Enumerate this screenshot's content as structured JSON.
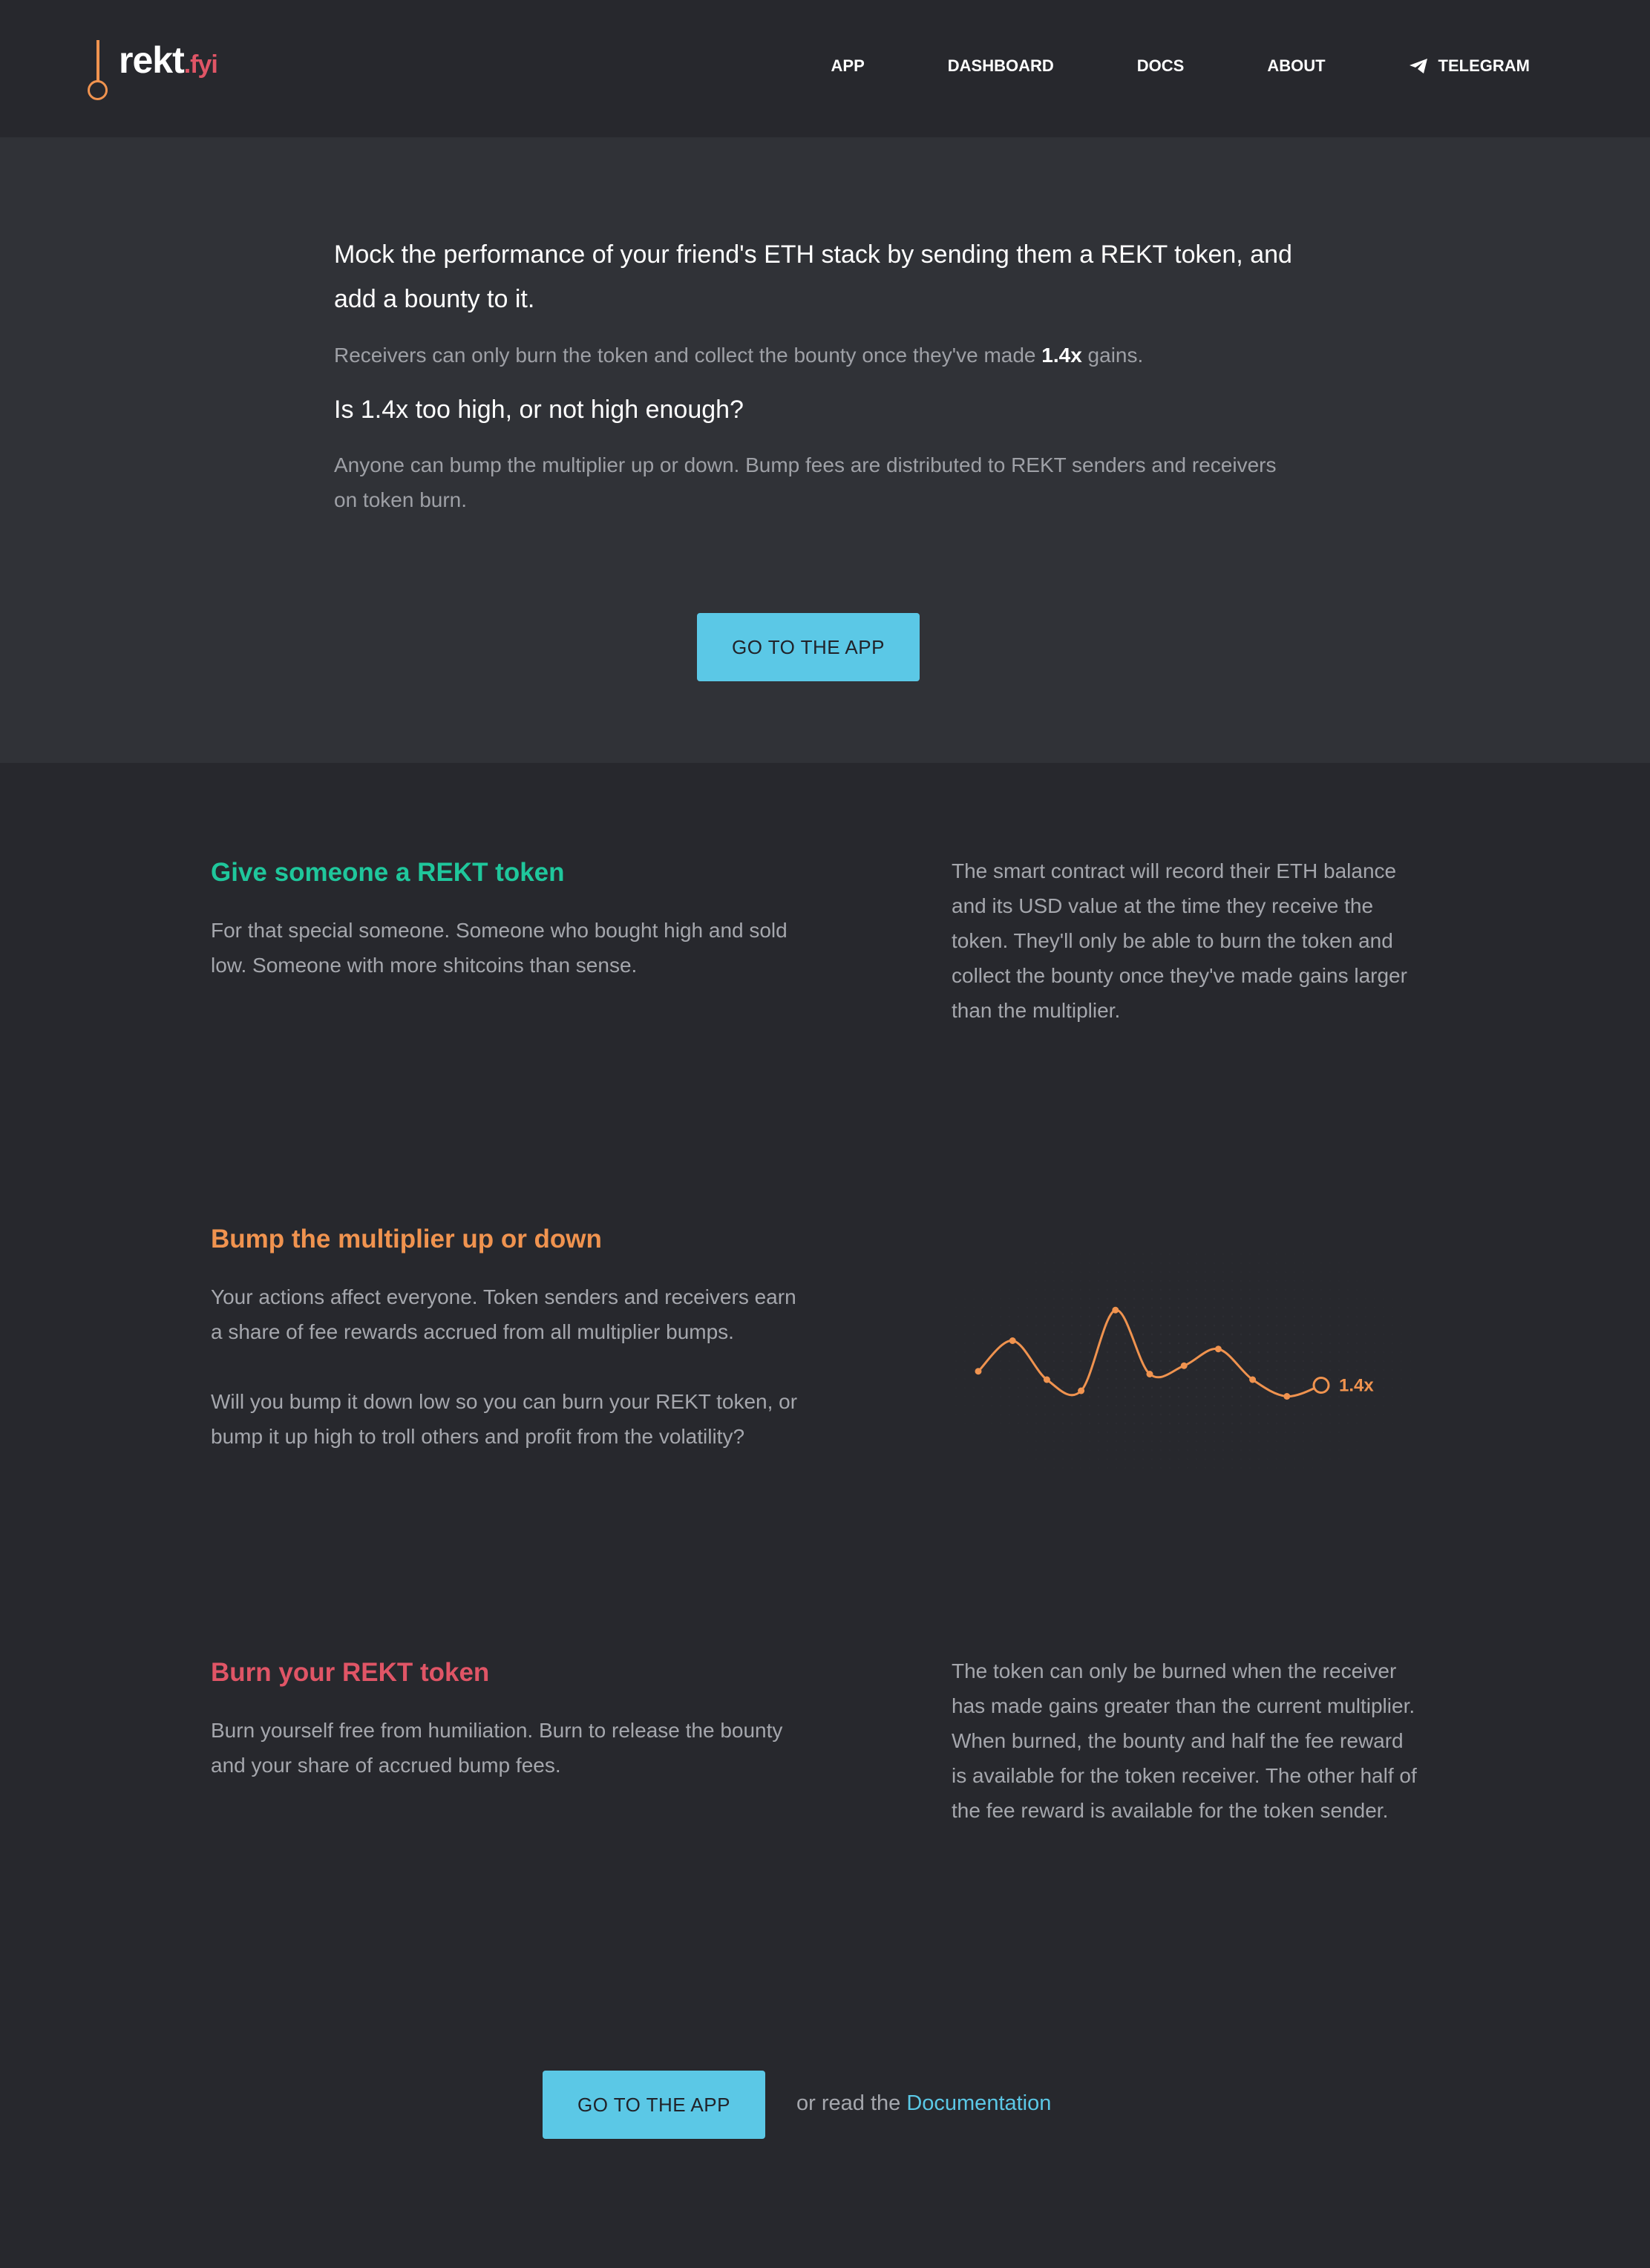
{
  "header": {
    "logo_main": "rekt",
    "logo_tld": ".fyi",
    "nav": [
      {
        "label": "APP"
      },
      {
        "label": "DASHBOARD"
      },
      {
        "label": "DOCS"
      },
      {
        "label": "ABOUT"
      },
      {
        "label": "TELEGRAM",
        "icon": "telegram-icon"
      }
    ]
  },
  "hero": {
    "lead": "Mock the performance of your friend's ETH stack by sending them a REKT token, and add a bounty to it.",
    "p1_before": "Receivers can only burn the token and collect the bounty once they've made ",
    "p1_bold": "1.4x",
    "p1_after": " gains.",
    "question": "Is 1.4x too high, or not high enough?",
    "p2": "Anyone can bump the multiplier up or down. Bump fees are distributed to REKT senders and receivers on token burn.",
    "button": "GO TO THE APP"
  },
  "sections": [
    {
      "title": "Give someone a REKT token",
      "left_text": "For that special someone. Someone who bought high and sold low. Someone with more shitcoins than sense.",
      "right_text": "The smart contract will record their ETH balance and its USD value at the time they receive the token. They'll only be able to burn the token and collect the bounty once they've made gains larger than the multiplier."
    },
    {
      "title": "Bump the multiplier up or down",
      "left_text_1": "Your actions affect everyone. Token senders and receivers earn a share of fee rewards accrued from all multiplier bumps.",
      "left_text_2": "Will you bump it down low so you can burn your REKT token, or bump it up high to troll others and profit from the volatility?",
      "chart_label": "1.4x"
    },
    {
      "title": "Burn your REKT token",
      "left_text": "Burn yourself free from humiliation. Burn to release the bounty and your share of accrued bump fees.",
      "right_text": "The token can only be burned when the receiver has made gains greater than the current multiplier. When burned, the bounty and half the fee reward is available for the token receiver. The other half of the fee reward is available for the token sender."
    }
  ],
  "cta": {
    "button": "GO TO THE APP",
    "text_before": "or read the ",
    "link": "Documentation"
  },
  "colors": {
    "accent_blue": "#5bc8e6",
    "green": "#1fc79c",
    "orange": "#f0934f",
    "red": "#e05566"
  },
  "chart_data": {
    "type": "line",
    "series": [
      {
        "values": [
          1.45,
          1.56,
          1.42,
          1.38,
          1.67,
          1.44,
          1.47,
          1.53,
          1.42,
          1.36,
          1.4
        ]
      }
    ],
    "current_label": "1.4x"
  }
}
